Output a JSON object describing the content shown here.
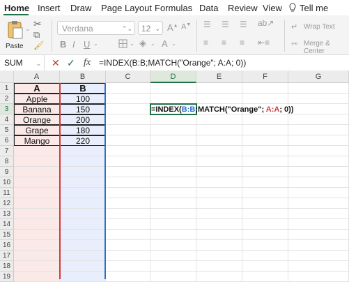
{
  "menu": {
    "items": [
      {
        "label": "Home",
        "active": true
      },
      {
        "label": "Insert"
      },
      {
        "label": "Draw"
      },
      {
        "label": "Page Layout"
      },
      {
        "label": "Formulas"
      },
      {
        "label": "Data"
      },
      {
        "label": "Review"
      },
      {
        "label": "View"
      },
      {
        "label": "Tell me"
      }
    ]
  },
  "ribbon": {
    "paste_label": "Paste",
    "font_name": "Verdana",
    "font_size": "12",
    "wrap_text_label": "Wrap Text",
    "merge_center_label": "Merge & Center"
  },
  "formula_bar": {
    "name_box": "SUM",
    "fx_label": "fx",
    "formula": "=INDEX(B:B;MATCH(\"Orange\"; A:A; 0))"
  },
  "sheet": {
    "columns": [
      "A",
      "B",
      "C",
      "D",
      "E",
      "F",
      "G"
    ],
    "rows": [
      "1",
      "2",
      "3",
      "4",
      "5",
      "6",
      "7",
      "8",
      "9",
      "10",
      "11",
      "12",
      "13",
      "14",
      "15",
      "16",
      "17",
      "18",
      "19"
    ],
    "data": [
      {
        "a": "A",
        "b": "B"
      },
      {
        "a": "Apple",
        "b": "100"
      },
      {
        "a": "Banana",
        "b": "150"
      },
      {
        "a": "Orange",
        "b": "200"
      },
      {
        "a": "Grape",
        "b": "180"
      },
      {
        "a": "Mango",
        "b": "220"
      }
    ],
    "active_cell": "D3",
    "editing_formula": {
      "prefix": "=INDEX(",
      "ref1": "B:B",
      "mid": ";MATCH(\"Orange\"; ",
      "ref2": "A:A",
      "suffix": "; 0))"
    }
  },
  "colors": {
    "accent": "#1e7145",
    "ref_a": "#d13a3a",
    "ref_b": "#2e6fd0"
  }
}
